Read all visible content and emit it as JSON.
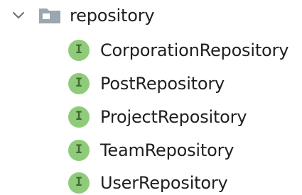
{
  "tree": {
    "folder": {
      "label": "repository",
      "expanded": true,
      "chevron_icon": "chevron-down-icon",
      "icon": "package-folder-icon",
      "icon_color": "#9aa7b1"
    },
    "children": [
      {
        "label": "CorporationRepository",
        "icon": "interface-icon",
        "icon_letter": "I"
      },
      {
        "label": "PostRepository",
        "icon": "interface-icon",
        "icon_letter": "I"
      },
      {
        "label": "ProjectRepository",
        "icon": "interface-icon",
        "icon_letter": "I"
      },
      {
        "label": "TeamRepository",
        "icon": "interface-icon",
        "icon_letter": "I"
      },
      {
        "label": "UserRepository",
        "icon": "interface-icon",
        "icon_letter": "I"
      }
    ],
    "colors": {
      "interface_icon_bg": "#8fcb7a",
      "interface_icon_letter": "#3e6b2d",
      "text": "#1f1f1f"
    }
  }
}
